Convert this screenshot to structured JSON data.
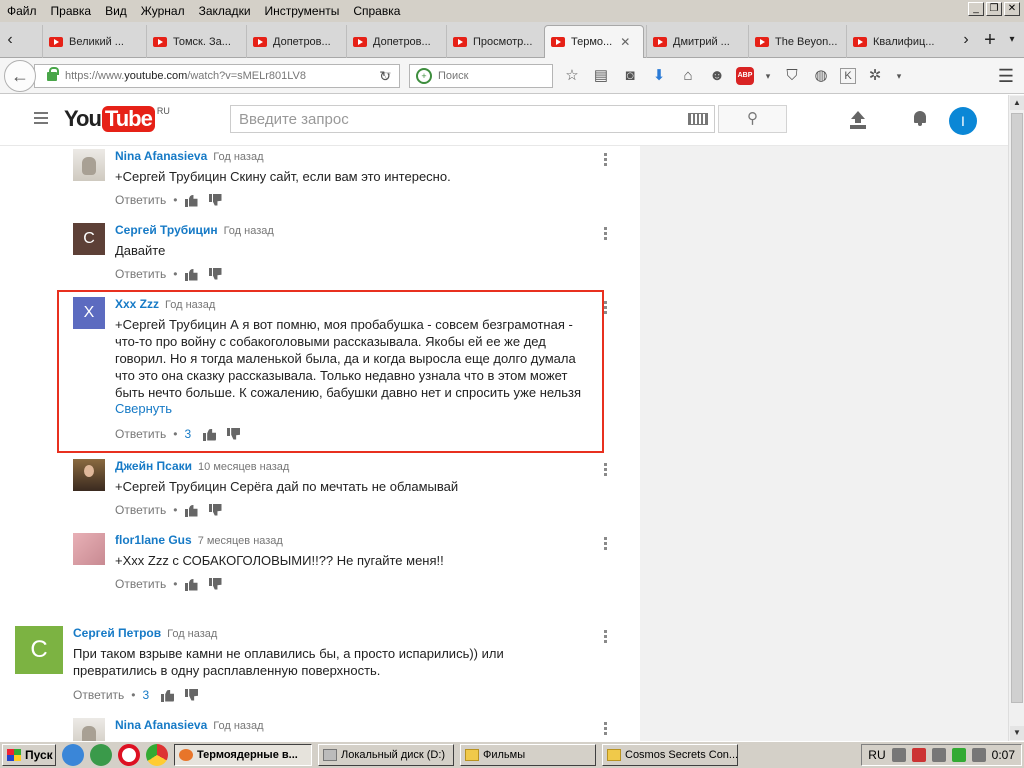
{
  "menubar": {
    "items": [
      "Файл",
      "Правка",
      "Вид",
      "Журнал",
      "Закладки",
      "Инструменты",
      "Справка"
    ]
  },
  "tabs": [
    {
      "label": "Великий ..."
    },
    {
      "label": "Томск. За..."
    },
    {
      "label": "Допетров..."
    },
    {
      "label": "Допетров..."
    },
    {
      "label": "Просмотр..."
    },
    {
      "label": "Термо...",
      "active": true
    },
    {
      "label": "Дмитрий ..."
    },
    {
      "label": "The Beyon..."
    },
    {
      "label": "Квалифиц..."
    }
  ],
  "navbar": {
    "url_prefix": "https://www.",
    "url_host": "youtube.com",
    "url_rest": "/watch?v=sMELr801LV8",
    "search_placeholder": "Поиск"
  },
  "youtube": {
    "logo_you": "You",
    "logo_tube": "Tube",
    "logo_region": "RU",
    "search_placeholder": "Введите запрос",
    "account_initial": "I"
  },
  "comments": [
    {
      "author": "Nina Afanasieva",
      "time": "Год назад",
      "text": "+Сергей Трубицин Скину сайт, если вам это интересно.",
      "reply": "Ответить",
      "avatar": "cat"
    },
    {
      "author": "Сергей Трубицин",
      "time": "Год назад",
      "text": "Давайте",
      "reply": "Ответить",
      "avatar_letter": "С",
      "avatar_color": "#5d4037"
    },
    {
      "author": "Xxx Zzz",
      "time": "Год назад",
      "text": "+Сергей Трубицин А я вот помню, моя пробабушка - совсем безграмотная - что-то про войну с собакоголовыми рассказывала. Якобы ей ее же дед говорил. Но я тогда маленькой была, да и когда выросла еще долго думала что это она сказку рассказывала. Только недавно узнала что в этом может быть нечто больше. К сожалению, бабушки давно нет и спросить уже нельзя",
      "collapse": "Свернуть",
      "reply": "Ответить",
      "likes": "3",
      "avatar_letter": "X",
      "avatar_color": "#5c6bc0"
    },
    {
      "author": "Джейн Псаки",
      "time": "10 месяцев назад",
      "text": "+Сергей Трубицин Серёга дай по мечтать не обламывай",
      "reply": "Ответить",
      "avatar": "woman"
    },
    {
      "author": "flor1lane Gus",
      "time": "7 месяцев назад",
      "text": "+Xxx Zzz с СОБАКОГОЛОВЫМИ!!?? Не пугайте меня!!",
      "reply": "Ответить",
      "avatar": "pink"
    },
    {
      "author": "Сергей Петров",
      "time": "Год назад",
      "text": "При таком взрыве камни не оплавились бы, а просто испарились)) или превратились в одну расплавленную поверхность.",
      "reply": "Ответить",
      "likes": "3",
      "avatar_letter": "С",
      "avatar_color": "#7cb342"
    },
    {
      "author": "Nina Afanasieva",
      "time": "Год назад",
      "avatar": "cat"
    }
  ],
  "taskbar": {
    "start": "Пуск",
    "tasks": [
      {
        "label": "Термоядерные в...",
        "active": true
      },
      {
        "label": "Локальный диск (D:)"
      },
      {
        "label": "Фильмы"
      },
      {
        "label": "Cosmos Secrets Con..."
      }
    ],
    "lang": "RU",
    "clock": "0:07"
  }
}
